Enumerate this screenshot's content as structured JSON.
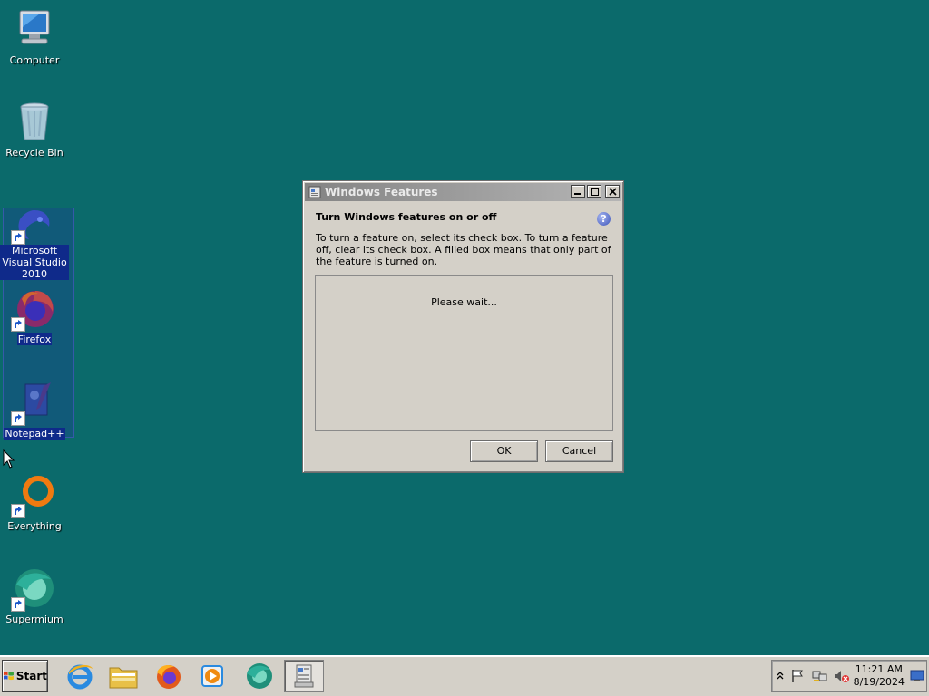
{
  "desktop": {
    "icons": [
      {
        "label": "Computer"
      },
      {
        "label": "Recycle Bin"
      },
      {
        "label": "Microsoft Visual Studio 2010"
      },
      {
        "label": "Firefox"
      },
      {
        "label": "Notepad++"
      },
      {
        "label": "Everything"
      },
      {
        "label": "Supermium"
      }
    ]
  },
  "dialog": {
    "title": "Windows Features",
    "heading": "Turn Windows features on or off",
    "description": "To turn a feature on, select its check box. To turn a feature off, clear its check box. A filled box means that only part of the feature is turned on.",
    "status": "Please wait...",
    "help_symbol": "?",
    "buttons": {
      "ok": "OK",
      "cancel": "Cancel"
    }
  },
  "taskbar": {
    "start_label": "Start",
    "pinned": [
      "internet-explorer-icon",
      "file-explorer-icon",
      "firefox-icon",
      "media-player-icon",
      "supermium-icon",
      "windows-features-icon"
    ],
    "clock": {
      "time": "11:21 AM",
      "date": "8/19/2024"
    }
  },
  "colors": {
    "desktop_background": "#0b6a6b",
    "dialog_face": "#d4d0c8",
    "titlebar_inactive": "#848484",
    "selection": "#0f2a8a"
  }
}
